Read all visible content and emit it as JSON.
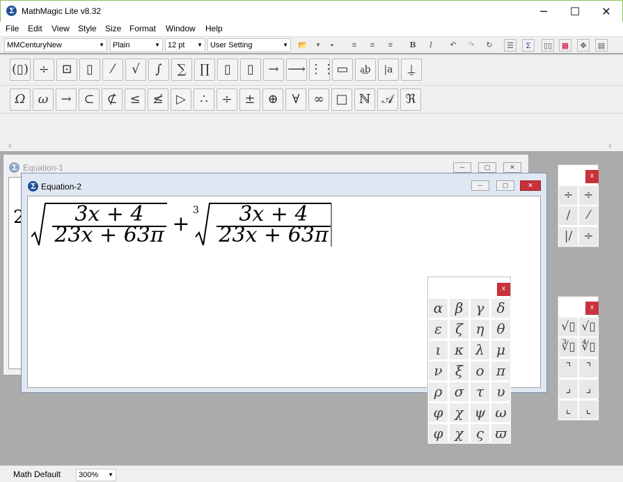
{
  "app": {
    "title": "MathMagic Lite v8.32",
    "logo_glyph": "Σ"
  },
  "window_controls": {
    "minimize": "─",
    "maximize": "☐",
    "close": "✕"
  },
  "menu": [
    "File",
    "Edit",
    "View",
    "Style",
    "Size",
    "Format",
    "Window",
    "Help"
  ],
  "format_bar": {
    "font": "MMCenturyNew",
    "style": "Plain",
    "size": "12 pt",
    "setting": "User Setting",
    "icons": [
      "open-folder-icon",
      "save-icon",
      "align-left-icon",
      "align-center-icon",
      "align-right-icon",
      "bold-icon",
      "italic-icon",
      "undo-icon",
      "redo-icon",
      "refresh-icon"
    ],
    "bold_label": "B",
    "italic_label": "I"
  },
  "template_buttons": [
    "(▯)",
    "÷",
    "⊡",
    "▯",
    "⁄",
    "√",
    "∫",
    "∑",
    "∏",
    "▯",
    "▯",
    "→",
    "⟶",
    "⋮⋮",
    "▭",
    "a͟b",
    "|a",
    "⍊"
  ],
  "symbol_buttons": [
    "Ω",
    "ω",
    "→",
    "⊂",
    "⊄",
    "≤",
    "≰",
    "▷",
    "∴",
    "÷",
    "±",
    "⊕",
    "∀",
    "∞",
    "□",
    "ℕ",
    "𝒜",
    "ℜ"
  ],
  "windows": {
    "eq1": {
      "title": "Equation-1",
      "partial_glyph": "2"
    },
    "eq2": {
      "title": "Equation-2"
    }
  },
  "formula": {
    "num": "3x + 4",
    "den": "23x + 63π",
    "plus": "+",
    "root_index": "3"
  },
  "greek_palette": {
    "close": "x",
    "letters": [
      "α",
      "β",
      "γ",
      "δ",
      "ε",
      "ζ",
      "η",
      "θ",
      "ι",
      "κ",
      "λ",
      "μ",
      "ν",
      "ξ",
      "ο",
      "π",
      "ρ",
      "σ",
      "τ",
      "υ",
      "φ",
      "χ",
      "ψ",
      "ω",
      "φ",
      "χ",
      "ς",
      "ϖ"
    ]
  },
  "fraction_palette": {
    "close": "x",
    "cells": [
      "÷",
      "÷",
      "∕",
      "⁄",
      "|/",
      "÷"
    ]
  },
  "root_palette": {
    "close": "x",
    "cells": [
      "√▯",
      "√▯",
      "∛▯",
      "∜▯",
      "⌝",
      "⌝",
      "⌟",
      "⌟",
      "⌞",
      "⌞"
    ]
  },
  "status": {
    "style": "Math Default",
    "zoom": "300%"
  },
  "scroll": {
    "left": "‹",
    "right": "›"
  }
}
